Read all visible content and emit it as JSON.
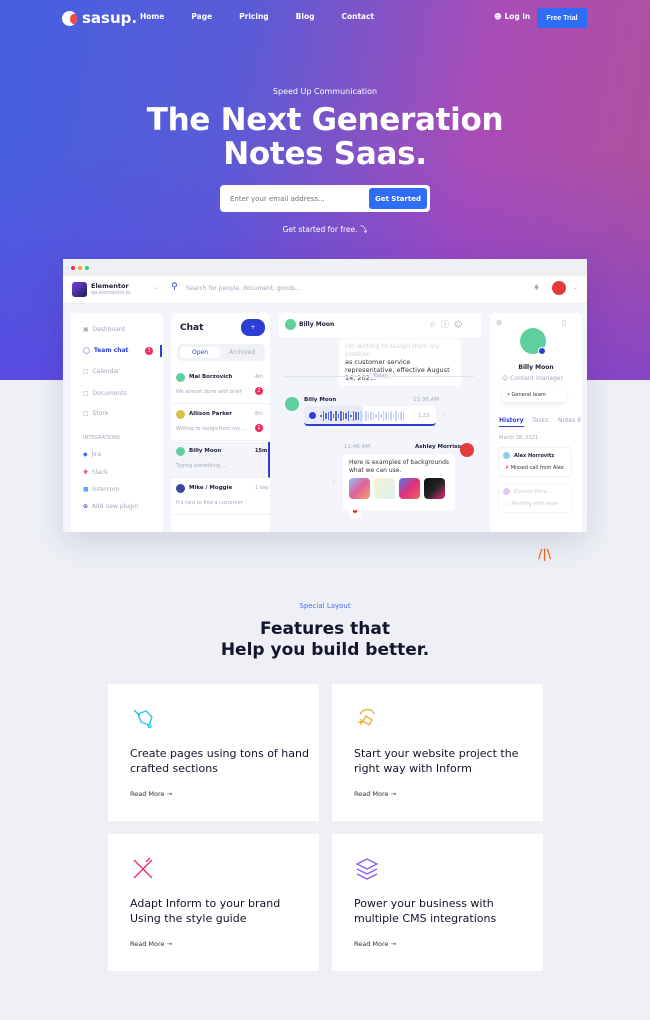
{
  "nav": {
    "brand": "sasup.",
    "items": [
      "Home",
      "Page",
      "Pricing",
      "Blog",
      "Contact"
    ],
    "login": "Log in",
    "cta": "Free Trial"
  },
  "hero": {
    "eyebrow": "Speed Up Communication",
    "title_line1": "The Next Generation",
    "title_line2": "Notes Saas.",
    "email_placeholder": "Enter your email address...",
    "submit": "Get Started",
    "free_link": "Get started for free."
  },
  "mockup": {
    "workspace": {
      "name": "Elementor",
      "domain": "qa.elementor.io"
    },
    "search_placeholder": "Search for people, document, goods...",
    "sidebar": {
      "items": [
        {
          "label": "Dashboard"
        },
        {
          "label": "Team chat",
          "badge": "3"
        },
        {
          "label": "Calendar"
        },
        {
          "label": "Documents"
        },
        {
          "label": "Store"
        }
      ],
      "integrations_heading": "INTEGRATIONS",
      "integrations": [
        "Jira",
        "Slack",
        "Intercom",
        "Add new plugin"
      ]
    },
    "chat": {
      "title": "Chat",
      "add": "+",
      "tabs": [
        "Open",
        "Archived"
      ],
      "list": [
        {
          "name": "Mai Borzovich",
          "time": "4m",
          "preview": "We almost done with brief",
          "badge": "2"
        },
        {
          "name": "Allison Parker",
          "time": "8m",
          "preview": "Writing to resign from my ...",
          "badge": "1"
        },
        {
          "name": "Billy Moon",
          "time": "15m",
          "preview": "Typing something ...",
          "badge": ""
        },
        {
          "name": "Mike / Moggie",
          "time": "1 day",
          "preview": "It's rare to find a customer",
          "badge": ""
        }
      ]
    },
    "conversation": {
      "contact": "Billy Moon",
      "msg1_clipped": "I'm writing to resign from my position",
      "msg1": "as customer service representative, effective August 14, 2020.",
      "divider": "Today",
      "voice": {
        "sender": "Billy Moon",
        "time": "11:36 AM",
        "duration": "1:23",
        "progress": 0.45
      },
      "msg2": {
        "sender": "Ashley Morrison",
        "time": "11:46 AM",
        "text": "Here is examples of backgrounds what we can use.",
        "reaction": "❤"
      }
    },
    "profile": {
      "name": "Billy Moon",
      "role": "Content manager",
      "team": "• General team",
      "tabs": [
        "History",
        "Tasks",
        "Notes 8"
      ],
      "date": "March 28, 2021",
      "entries": [
        {
          "name": "Alex Horrovitz",
          "note": "Missed call from Alex"
        },
        {
          "name": "Eleanor Pena",
          "note": "Meeting with team"
        }
      ]
    }
  },
  "features": {
    "eyebrow": "Special Layout",
    "title_line1": "Features that",
    "title_line2": "Help you build better.",
    "cards": [
      {
        "icon": "paint-brush-icon",
        "title": "Create pages using tons of hand crafted sections",
        "link": "Read More →",
        "color": "#1ec5e8"
      },
      {
        "icon": "pen-tool-icon",
        "title": "Start your website project the right way with Inform",
        "link": "Read More →",
        "color": "#f5a623"
      },
      {
        "icon": "ruler-pencil-icon",
        "title": "Adapt Inform to your brand Using the style guide",
        "link": "Read More →",
        "color": "#f2295b"
      },
      {
        "icon": "layers-icon",
        "title": "Power your business with multiple CMS integrations",
        "link": "Read More →",
        "color": "#8b5cf6"
      }
    ]
  },
  "colors": {
    "accent": "#2f6df6",
    "badge": "#f2295b",
    "chat_accent": "#2c3ed6"
  }
}
